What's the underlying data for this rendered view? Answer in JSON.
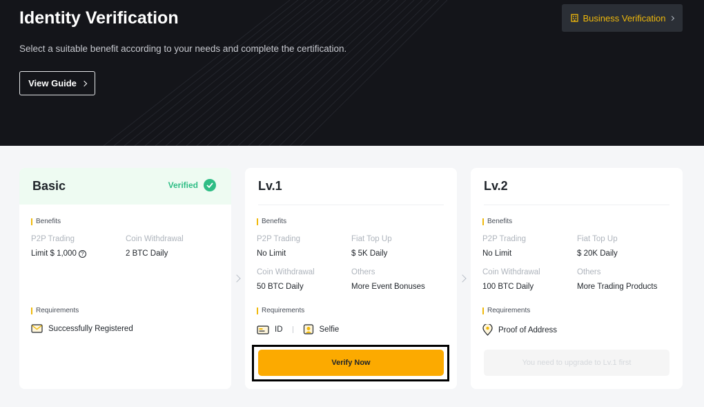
{
  "header": {
    "title": "Identity Verification",
    "subtitle": "Select a suitable benefit according to your needs and complete the certification.",
    "guide_label": "View Guide",
    "business_label": "Business Verification"
  },
  "labels": {
    "benefits": "Benefits",
    "requirements": "Requirements"
  },
  "basic": {
    "title": "Basic",
    "status": "Verified",
    "benefits": [
      {
        "label": "P2P Trading",
        "value": "Limit $ 1,000"
      },
      {
        "label": "Coin Withdrawal",
        "value": "2 BTC Daily"
      }
    ],
    "requirement": "Successfully Registered"
  },
  "lv1": {
    "title": "Lv.1",
    "benefits": [
      {
        "label": "P2P Trading",
        "value": "No Limit"
      },
      {
        "label": "Fiat Top Up",
        "value": "$ 5K Daily"
      },
      {
        "label": "Coin Withdrawal",
        "value": "50 BTC Daily"
      },
      {
        "label": "Others",
        "value": "More Event Bonuses"
      }
    ],
    "requirements": [
      "ID",
      "Selfie"
    ],
    "action_label": "Verify Now"
  },
  "lv2": {
    "title": "Lv.2",
    "benefits": [
      {
        "label": "P2P Trading",
        "value": "No Limit"
      },
      {
        "label": "Fiat Top Up",
        "value": "$ 20K Daily"
      },
      {
        "label": "Coin Withdrawal",
        "value": "100 BTC Daily"
      },
      {
        "label": "Others",
        "value": "More Trading Products"
      }
    ],
    "requirement": "Proof of Address",
    "action_label": "You need to upgrade to Lv.1 first"
  },
  "colors": {
    "accent": "#fcaa00",
    "brand_yellow": "#f0b90b",
    "verified_green": "#2ebd85",
    "hero_bg": "#14151a"
  },
  "icons": {
    "business": "building-icon",
    "guide": "chevron-right-icon",
    "verified": "check-circle-icon",
    "info": "question-circle-icon",
    "registered": "envelope-icon",
    "id": "id-card-icon",
    "selfie": "selfie-icon",
    "address": "location-pin-icon"
  }
}
